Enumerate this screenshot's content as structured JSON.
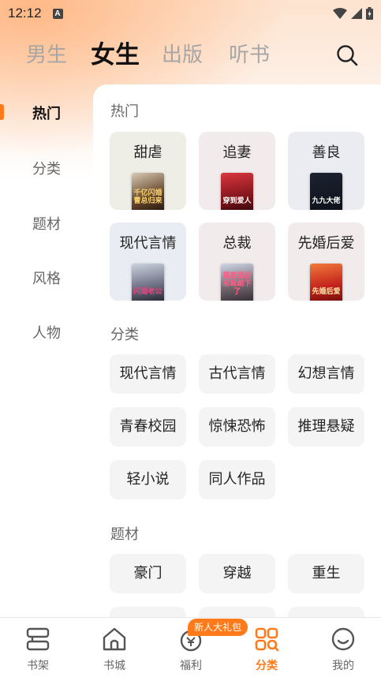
{
  "status_bar": {
    "time": "12:12",
    "badge": "A"
  },
  "tabs": [
    {
      "label": "男生",
      "active": false
    },
    {
      "label": "女生",
      "active": true
    },
    {
      "label": "出版",
      "active": false
    },
    {
      "label": "听书",
      "active": false
    }
  ],
  "search_icon": "search-icon",
  "sidebar": {
    "items": [
      {
        "label": "热门",
        "active": true
      },
      {
        "label": "分类",
        "active": false
      },
      {
        "label": "题材",
        "active": false
      },
      {
        "label": "风格",
        "active": false
      },
      {
        "label": "人物",
        "active": false
      }
    ]
  },
  "sections": {
    "hot": {
      "title": "热门",
      "items": [
        {
          "label": "甜虐",
          "book_text": "千亿闪婚\n曹总归来",
          "bg": "#eeeee6"
        },
        {
          "label": "追妻",
          "book_text": "穿到爱人",
          "bg": "#f2ebeb"
        },
        {
          "label": "善良",
          "book_text": "九九大佬",
          "bg": "#ebecf1"
        },
        {
          "label": "现代言情",
          "book_text": "闪婚老公",
          "bg": "#e9ecf2"
        },
        {
          "label": "总裁",
          "book_text": "提离婚后\n总裁跪下了",
          "bg": "#f2ebeb"
        },
        {
          "label": "先婚后爱",
          "book_text": "先婚后爱",
          "bg": "#f2ebeb"
        }
      ]
    },
    "category": {
      "title": "分类",
      "items": [
        "现代言情",
        "古代言情",
        "幻想言情",
        "青春校园",
        "惊悚恐怖",
        "推理悬疑",
        "轻小说",
        "同人作品"
      ]
    },
    "theme": {
      "title": "题材",
      "items": [
        "豪门",
        "穿越",
        "重生"
      ]
    }
  },
  "bottom_nav": {
    "items": [
      {
        "label": "书架",
        "icon": "bookshelf-icon",
        "active": false
      },
      {
        "label": "书城",
        "icon": "bookstore-icon",
        "active": false
      },
      {
        "label": "福利",
        "icon": "welfare-icon",
        "active": false
      },
      {
        "label": "分类",
        "icon": "category-icon",
        "active": true
      },
      {
        "label": "我的",
        "icon": "profile-icon",
        "active": false
      }
    ],
    "gift_badge": "新人大礼包"
  },
  "colors": {
    "accent": "#ff7a1a"
  }
}
